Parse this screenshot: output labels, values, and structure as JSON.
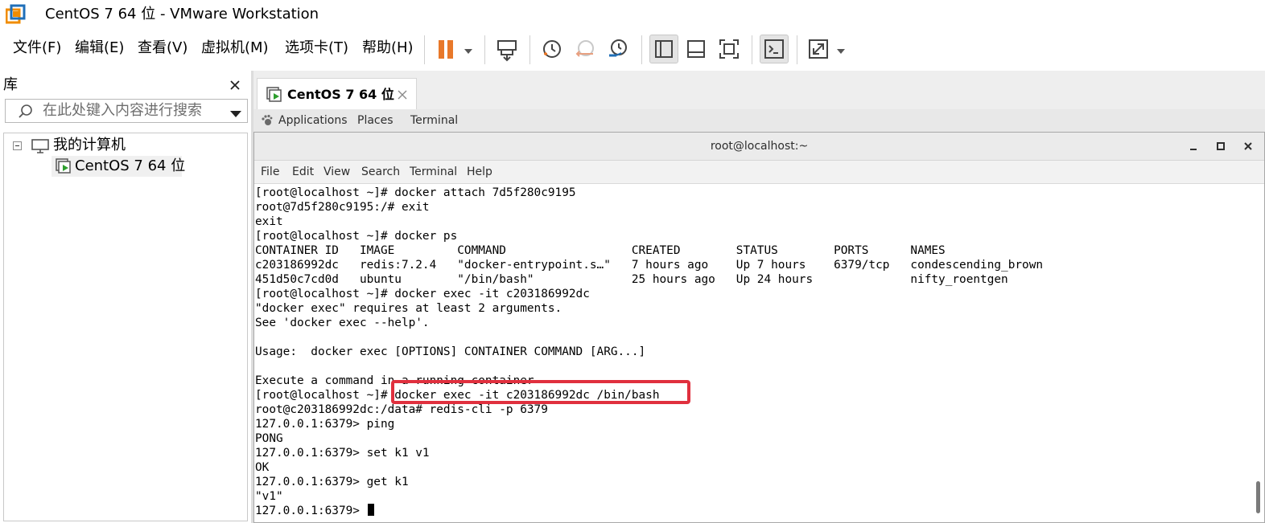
{
  "window": {
    "title": "CentOS 7 64 位 - VMware Workstation"
  },
  "menubar": {
    "items": [
      "文件(F)",
      "编辑(E)",
      "查看(V)",
      "虚拟机(M)",
      "选项卡(T)",
      "帮助(H)"
    ]
  },
  "toolbar": {
    "icons": [
      "pause-icon",
      "send-ctrl-alt-del-icon",
      "snapshot-icon",
      "revert-snapshot-icon",
      "snapshot-manager-icon",
      "show-library-icon",
      "thumbnail-bar-icon",
      "fullscreen-icon",
      "console-view-icon",
      "stretch-guest-icon"
    ],
    "accent": "#e8782a"
  },
  "library": {
    "title": "库",
    "search_placeholder": "在此处键入内容进行搜索",
    "tree": {
      "root": "我的计算机",
      "children": [
        "CentOS 7 64 位"
      ]
    }
  },
  "vm_tab": {
    "label": "CentOS 7 64 位"
  },
  "gnome": {
    "menu": [
      "Applications",
      "Places",
      "Terminal"
    ]
  },
  "terminal": {
    "title": "root@localhost:~",
    "menu": [
      "File",
      "Edit",
      "View",
      "Search",
      "Terminal",
      "Help"
    ],
    "lines": [
      "[root@localhost ~]# docker attach 7d5f280c9195",
      "root@7d5f280c9195:/# exit",
      "exit",
      "[root@localhost ~]# docker ps",
      "CONTAINER ID   IMAGE         COMMAND                  CREATED        STATUS        PORTS      NAMES",
      "c203186992dc   redis:7.2.4   \"docker-entrypoint.s…\"   7 hours ago    Up 7 hours    6379/tcp   condescending_brown",
      "451d50c7cd0d   ubuntu        \"/bin/bash\"              25 hours ago   Up 24 hours              nifty_roentgen",
      "[root@localhost ~]# docker exec -it c203186992dc",
      "\"docker exec\" requires at least 2 arguments.",
      "See 'docker exec --help'.",
      "",
      "Usage:  docker exec [OPTIONS] CONTAINER COMMAND [ARG...]",
      "",
      "Execute a command in a running container",
      "[root@localhost ~]# docker exec -it c203186992dc /bin/bash",
      "root@c203186992dc:/data# redis-cli -p 6379",
      "127.0.0.1:6379> ping",
      "PONG",
      "127.0.0.1:6379> set k1 v1",
      "OK",
      "127.0.0.1:6379> get k1",
      "\"v1\"",
      "127.0.0.1:6379> "
    ],
    "highlight_color": "#e0303e"
  }
}
